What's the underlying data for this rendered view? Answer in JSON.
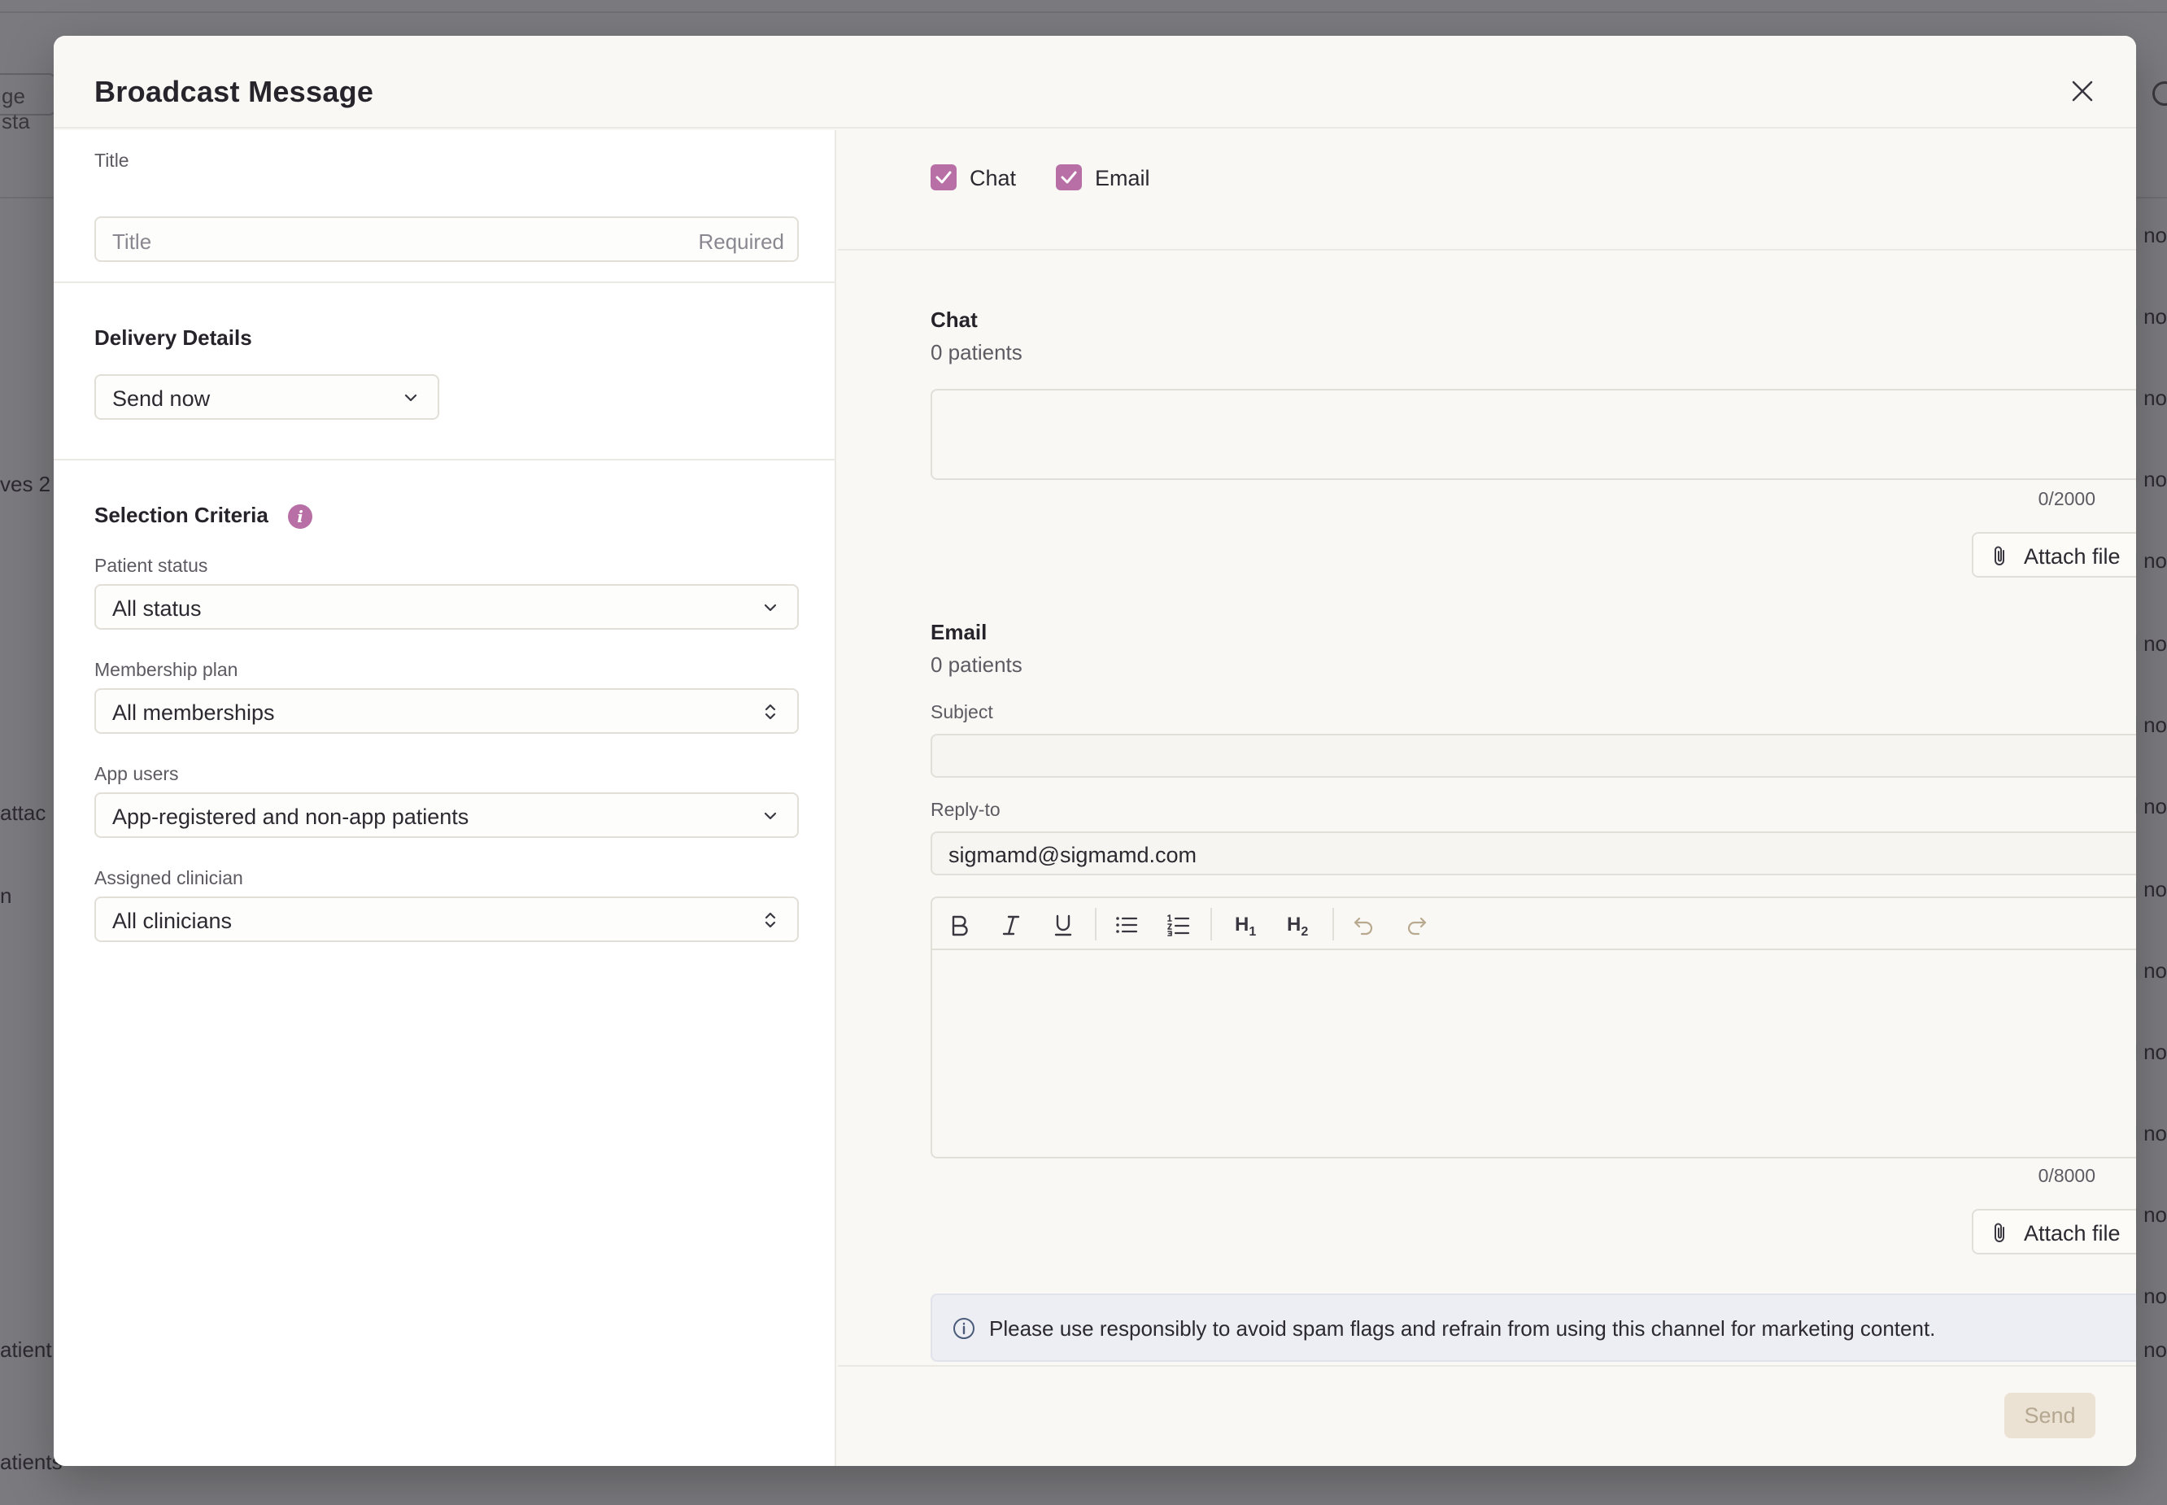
{
  "modal": {
    "title": "Broadcast Message"
  },
  "left": {
    "title_field": {
      "label": "Title",
      "placeholder": "Title",
      "hint": "Required"
    },
    "delivery": {
      "heading": "Delivery Details",
      "value": "Send now"
    },
    "selection": {
      "heading": "Selection Criteria",
      "info_icon": "i",
      "patient_status": {
        "label": "Patient status",
        "value": "All status"
      },
      "membership_plan": {
        "label": "Membership plan",
        "value": "All memberships"
      },
      "app_users": {
        "label": "App users",
        "value": "App-registered and non-app patients"
      },
      "assigned_clinician": {
        "label": "Assigned clinician",
        "value": "All clinicians"
      }
    }
  },
  "right": {
    "channels": [
      {
        "label": "Chat",
        "checked": true
      },
      {
        "label": "Email",
        "checked": true
      }
    ],
    "chat": {
      "heading": "Chat",
      "patients": "0 patients",
      "counter": "0/2000",
      "attach_label": "Attach file"
    },
    "email": {
      "heading": "Email",
      "patients": "0 patients",
      "subject_label": "Subject",
      "subject_value": "",
      "reply_to_label": "Reply-to",
      "reply_to_value": "sigmamd@sigmamd.com",
      "toolbar": {
        "h1": "H",
        "h1_sub": "1",
        "h2": "H",
        "h2_sub": "2"
      },
      "counter": "0/8000",
      "attach_label": "Attach file"
    },
    "notice": "Please use responsibly to avoid spam flags and refrain from using this channel for marketing content.",
    "send_label": "Send"
  },
  "background": {
    "snippets": [
      "ge sta",
      "ves 2",
      "attac",
      "n",
      "atient",
      "atients",
      "d no"
    ]
  },
  "colors": {
    "accent": "#b86fa6",
    "send_disabled_bg": "#ebe2d4",
    "notice_bg": "#eceef3"
  }
}
